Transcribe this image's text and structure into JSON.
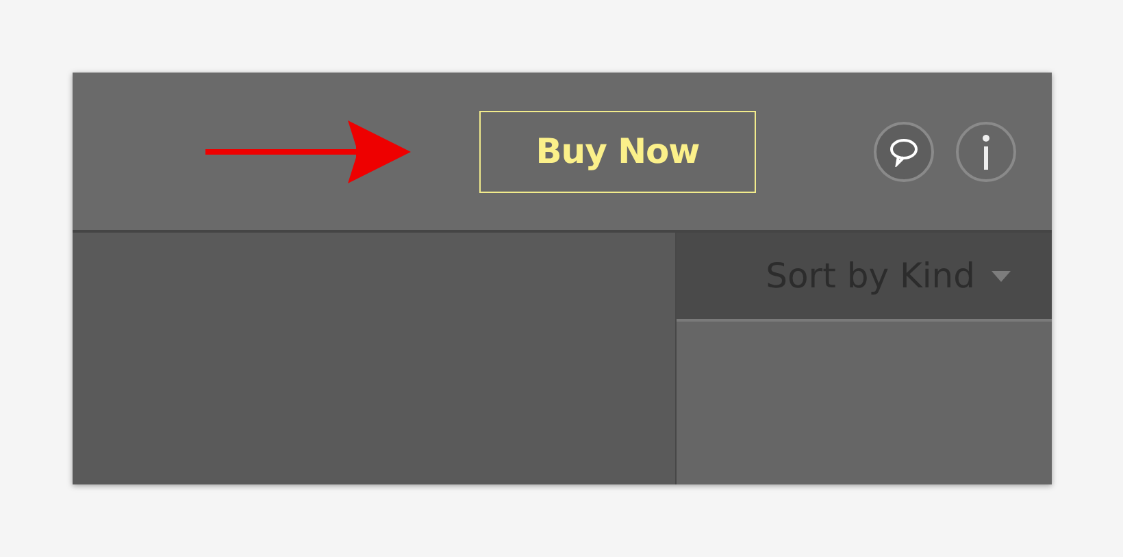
{
  "toolbar": {
    "buy_button": "Buy Now"
  },
  "list_header": {
    "sort_label": "Sort by Kind"
  }
}
